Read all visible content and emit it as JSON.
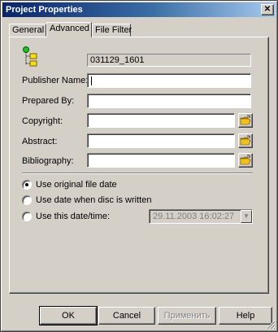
{
  "window": {
    "title": "Project Properties",
    "close_label": "✕"
  },
  "tabs": [
    {
      "label": "General",
      "active": false
    },
    {
      "label": "Advanced",
      "active": true
    },
    {
      "label": "File Filter",
      "active": false
    }
  ],
  "advanced": {
    "project_id": "031129_1601",
    "fields": [
      {
        "label": "Publisher Name:",
        "value": "",
        "has_browse": false,
        "focused": true
      },
      {
        "label": "Prepared By:",
        "value": "",
        "has_browse": false,
        "focused": false
      },
      {
        "label": "Copyright:",
        "value": "",
        "has_browse": true,
        "focused": false
      },
      {
        "label": "Abstract:",
        "value": "",
        "has_browse": true,
        "focused": false
      },
      {
        "label": "Bibliography:",
        "value": "",
        "has_browse": true,
        "focused": false
      }
    ],
    "date_options": [
      {
        "label": "Use original file date",
        "selected": true
      },
      {
        "label": "Use date when disc is written",
        "selected": false
      },
      {
        "label": "Use this date/time:",
        "selected": false
      }
    ],
    "custom_date": "29.11.2003 16:02:27"
  },
  "buttons": {
    "ok": "OK",
    "cancel": "Cancel",
    "apply": "Применить",
    "help": "Help"
  },
  "colors": {
    "titlebar_start": "#0a246a",
    "titlebar_end": "#a6caf0",
    "face": "#d4d0c8",
    "folder_icon": "#f0c020"
  }
}
